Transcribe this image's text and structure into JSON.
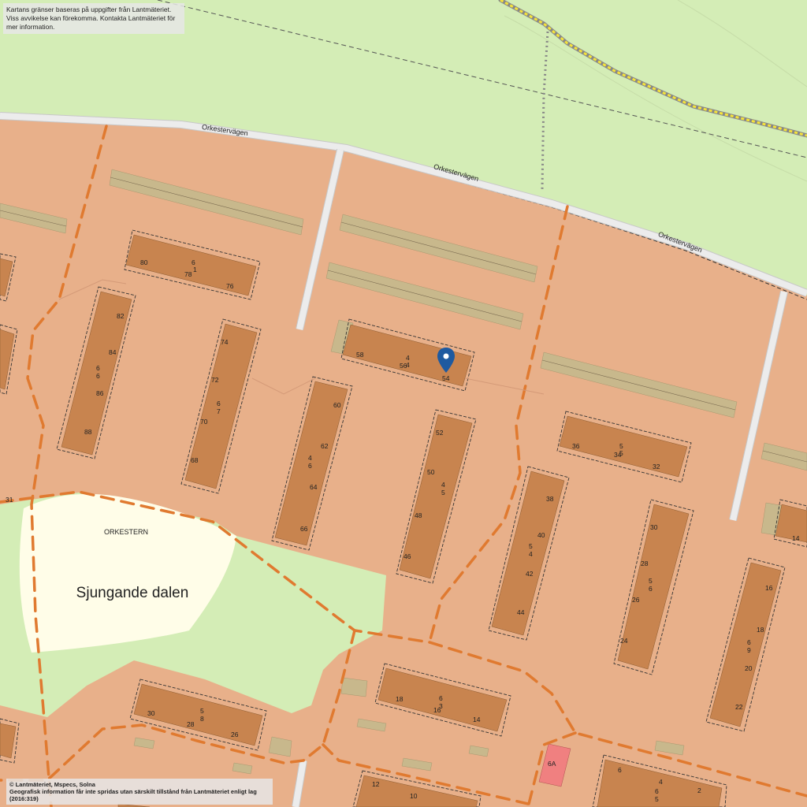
{
  "map": {
    "area_label": "ORKESTERN",
    "park_label": "Sjungande dalen",
    "street_label": "Orkestervägen",
    "pin_color": "#1e5aa0",
    "colors": {
      "residential": "#e8b08a",
      "park": "#d4edb6",
      "open_area": "#fffde8",
      "building": "#c8844f",
      "parking": "#c8b88c",
      "path": "#e07a30",
      "road": "#e6e6e6",
      "highlight_building": "#f08080"
    }
  },
  "attribution": {
    "top_line1": "Kartans gränser baseras på uppgifter från Lantmäteriet.",
    "top_line2": "Viss avvikelse kan förekomma. Kontakta Lantmäteriet för mer information.",
    "bottom_line1": "© Lantmäteriet, Mspecs, Solna",
    "bottom_line2": "Geografisk information får inte spridas utan särskilt tillstånd från Lantmäteriet enligt lag (2016:319)"
  },
  "address_labels": [
    "80",
    "6",
    "1",
    "78",
    "76",
    "82",
    "84",
    "6",
    "6",
    "86",
    "88",
    "74",
    "72",
    "6",
    "7",
    "70",
    "68",
    "58",
    "4",
    "4",
    "56",
    "54",
    "60",
    "62",
    "4",
    "6",
    "64",
    "66",
    "52",
    "50",
    "4",
    "5",
    "48",
    "46",
    "36",
    "5",
    "34",
    "5",
    "32",
    "38",
    "40",
    "5",
    "4",
    "42",
    "44",
    "30",
    "28",
    "5",
    "6",
    "26",
    "24",
    "16",
    "18",
    "6",
    "9",
    "20",
    "22",
    "14",
    "31",
    "18",
    "6",
    "3",
    "16",
    "14",
    "30",
    "5",
    "8",
    "28",
    "26",
    "6A",
    "6",
    "4",
    "6",
    "5",
    "2",
    "12",
    "10"
  ]
}
